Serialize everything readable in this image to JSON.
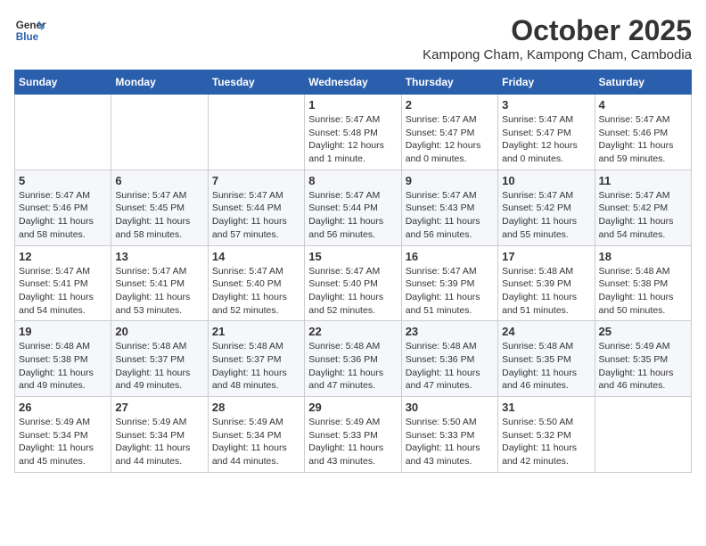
{
  "header": {
    "logo_line1": "General",
    "logo_line2": "Blue",
    "month": "October 2025",
    "location": "Kampong Cham, Kampong Cham, Cambodia"
  },
  "weekdays": [
    "Sunday",
    "Monday",
    "Tuesday",
    "Wednesday",
    "Thursday",
    "Friday",
    "Saturday"
  ],
  "weeks": [
    [
      {
        "day": "",
        "info": ""
      },
      {
        "day": "",
        "info": ""
      },
      {
        "day": "",
        "info": ""
      },
      {
        "day": "1",
        "info": "Sunrise: 5:47 AM\nSunset: 5:48 PM\nDaylight: 12 hours\nand 1 minute."
      },
      {
        "day": "2",
        "info": "Sunrise: 5:47 AM\nSunset: 5:47 PM\nDaylight: 12 hours\nand 0 minutes."
      },
      {
        "day": "3",
        "info": "Sunrise: 5:47 AM\nSunset: 5:47 PM\nDaylight: 12 hours\nand 0 minutes."
      },
      {
        "day": "4",
        "info": "Sunrise: 5:47 AM\nSunset: 5:46 PM\nDaylight: 11 hours\nand 59 minutes."
      }
    ],
    [
      {
        "day": "5",
        "info": "Sunrise: 5:47 AM\nSunset: 5:46 PM\nDaylight: 11 hours\nand 58 minutes."
      },
      {
        "day": "6",
        "info": "Sunrise: 5:47 AM\nSunset: 5:45 PM\nDaylight: 11 hours\nand 58 minutes."
      },
      {
        "day": "7",
        "info": "Sunrise: 5:47 AM\nSunset: 5:44 PM\nDaylight: 11 hours\nand 57 minutes."
      },
      {
        "day": "8",
        "info": "Sunrise: 5:47 AM\nSunset: 5:44 PM\nDaylight: 11 hours\nand 56 minutes."
      },
      {
        "day": "9",
        "info": "Sunrise: 5:47 AM\nSunset: 5:43 PM\nDaylight: 11 hours\nand 56 minutes."
      },
      {
        "day": "10",
        "info": "Sunrise: 5:47 AM\nSunset: 5:42 PM\nDaylight: 11 hours\nand 55 minutes."
      },
      {
        "day": "11",
        "info": "Sunrise: 5:47 AM\nSunset: 5:42 PM\nDaylight: 11 hours\nand 54 minutes."
      }
    ],
    [
      {
        "day": "12",
        "info": "Sunrise: 5:47 AM\nSunset: 5:41 PM\nDaylight: 11 hours\nand 54 minutes."
      },
      {
        "day": "13",
        "info": "Sunrise: 5:47 AM\nSunset: 5:41 PM\nDaylight: 11 hours\nand 53 minutes."
      },
      {
        "day": "14",
        "info": "Sunrise: 5:47 AM\nSunset: 5:40 PM\nDaylight: 11 hours\nand 52 minutes."
      },
      {
        "day": "15",
        "info": "Sunrise: 5:47 AM\nSunset: 5:40 PM\nDaylight: 11 hours\nand 52 minutes."
      },
      {
        "day": "16",
        "info": "Sunrise: 5:47 AM\nSunset: 5:39 PM\nDaylight: 11 hours\nand 51 minutes."
      },
      {
        "day": "17",
        "info": "Sunrise: 5:48 AM\nSunset: 5:39 PM\nDaylight: 11 hours\nand 51 minutes."
      },
      {
        "day": "18",
        "info": "Sunrise: 5:48 AM\nSunset: 5:38 PM\nDaylight: 11 hours\nand 50 minutes."
      }
    ],
    [
      {
        "day": "19",
        "info": "Sunrise: 5:48 AM\nSunset: 5:38 PM\nDaylight: 11 hours\nand 49 minutes."
      },
      {
        "day": "20",
        "info": "Sunrise: 5:48 AM\nSunset: 5:37 PM\nDaylight: 11 hours\nand 49 minutes."
      },
      {
        "day": "21",
        "info": "Sunrise: 5:48 AM\nSunset: 5:37 PM\nDaylight: 11 hours\nand 48 minutes."
      },
      {
        "day": "22",
        "info": "Sunrise: 5:48 AM\nSunset: 5:36 PM\nDaylight: 11 hours\nand 47 minutes."
      },
      {
        "day": "23",
        "info": "Sunrise: 5:48 AM\nSunset: 5:36 PM\nDaylight: 11 hours\nand 47 minutes."
      },
      {
        "day": "24",
        "info": "Sunrise: 5:48 AM\nSunset: 5:35 PM\nDaylight: 11 hours\nand 46 minutes."
      },
      {
        "day": "25",
        "info": "Sunrise: 5:49 AM\nSunset: 5:35 PM\nDaylight: 11 hours\nand 46 minutes."
      }
    ],
    [
      {
        "day": "26",
        "info": "Sunrise: 5:49 AM\nSunset: 5:34 PM\nDaylight: 11 hours\nand 45 minutes."
      },
      {
        "day": "27",
        "info": "Sunrise: 5:49 AM\nSunset: 5:34 PM\nDaylight: 11 hours\nand 44 minutes."
      },
      {
        "day": "28",
        "info": "Sunrise: 5:49 AM\nSunset: 5:34 PM\nDaylight: 11 hours\nand 44 minutes."
      },
      {
        "day": "29",
        "info": "Sunrise: 5:49 AM\nSunset: 5:33 PM\nDaylight: 11 hours\nand 43 minutes."
      },
      {
        "day": "30",
        "info": "Sunrise: 5:50 AM\nSunset: 5:33 PM\nDaylight: 11 hours\nand 43 minutes."
      },
      {
        "day": "31",
        "info": "Sunrise: 5:50 AM\nSunset: 5:32 PM\nDaylight: 11 hours\nand 42 minutes."
      },
      {
        "day": "",
        "info": ""
      }
    ]
  ]
}
